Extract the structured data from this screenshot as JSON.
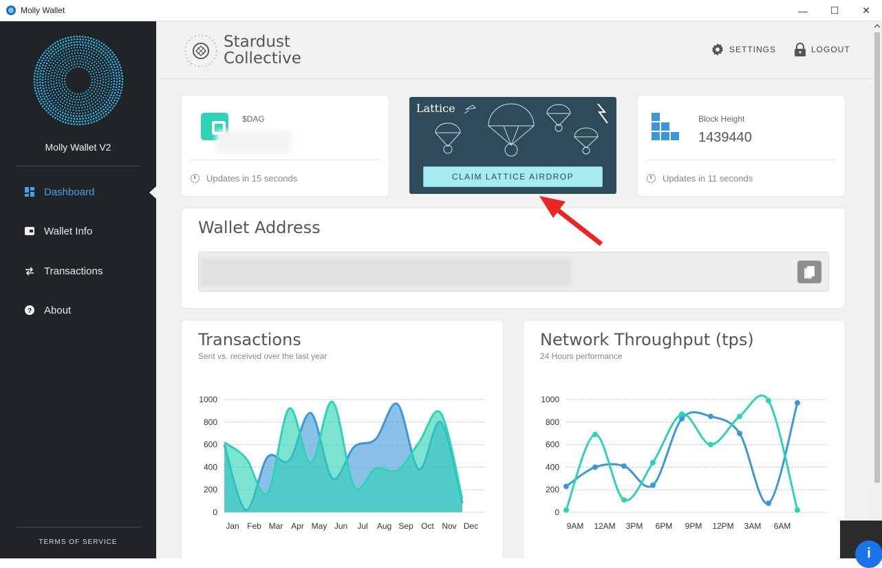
{
  "window": {
    "title": "Molly Wallet",
    "min_glyph": "—",
    "max_glyph": "☐",
    "close_glyph": "✕"
  },
  "sidebar": {
    "wallet_name": "Molly Wallet V2",
    "items": [
      {
        "label": "Dashboard",
        "icon": "dashboard-icon",
        "active": true
      },
      {
        "label": "Wallet Info",
        "icon": "wallet-icon",
        "active": false
      },
      {
        "label": "Transactions",
        "icon": "transfer-icon",
        "active": false
      },
      {
        "label": "About",
        "icon": "help-icon",
        "active": false
      }
    ],
    "terms_label": "TERMS OF SERVICE"
  },
  "header": {
    "brand_line1": "Stardust",
    "brand_line2": "Collective",
    "settings_label": "SETTINGS",
    "logout_label": "LOGOUT"
  },
  "dag_card": {
    "label": "$DAG",
    "value_hidden": true,
    "update_text": "Updates in 15 seconds"
  },
  "lattice_card": {
    "title": "Lattice",
    "button_label": "CLAIM LATTICE AIRDROP"
  },
  "block_card": {
    "label": "Block Height",
    "value": "1439440",
    "update_text": "Updates in 11 seconds"
  },
  "wallet_address": {
    "title": "Wallet Address",
    "value_hidden": true
  },
  "colors": {
    "accent": "#3da4e8",
    "teal": "#2ed3b7",
    "blue": "#3b97d8",
    "sidebar_bg": "#212426"
  },
  "chart_data": [
    {
      "type": "area",
      "title": "Transactions",
      "subtitle": "Sent vs. received over the last year",
      "categories": [
        "Jan",
        "Feb",
        "Mar",
        "Apr",
        "May",
        "Jun",
        "Jul",
        "Aug",
        "Sep",
        "Oct",
        "Nov",
        "Dec"
      ],
      "series": [
        {
          "values": [
            600,
            20,
            490,
            460,
            880,
            300,
            580,
            650,
            960,
            380,
            800,
            80
          ],
          "color": "#3b97d8"
        },
        {
          "values": [
            620,
            480,
            170,
            920,
            440,
            980,
            230,
            390,
            370,
            620,
            880,
            120
          ],
          "color": "#2ed3b7"
        }
      ],
      "ylim": [
        0,
        1000
      ],
      "yticks": [
        "1000",
        "800",
        "600",
        "400",
        "200",
        "0"
      ],
      "grid": true
    },
    {
      "type": "line",
      "title": "Network Throughput (tps)",
      "subtitle": "24 Hours performance",
      "categories": [
        "9AM",
        "12AM",
        "3PM",
        "6PM",
        "9PM",
        "12PM",
        "3AM",
        "6AM"
      ],
      "series": [
        {
          "values": [
            230,
            400,
            410,
            240,
            830,
            850,
            700,
            80,
            970
          ],
          "color": "#3b97d8"
        },
        {
          "values": [
            20,
            690,
            110,
            440,
            870,
            600,
            850,
            990,
            20
          ],
          "color": "#2ed3b7"
        }
      ],
      "ylim": [
        0,
        1000
      ],
      "yticks": [
        "1000",
        "800",
        "600",
        "400",
        "200",
        "0"
      ],
      "grid": true
    }
  ]
}
